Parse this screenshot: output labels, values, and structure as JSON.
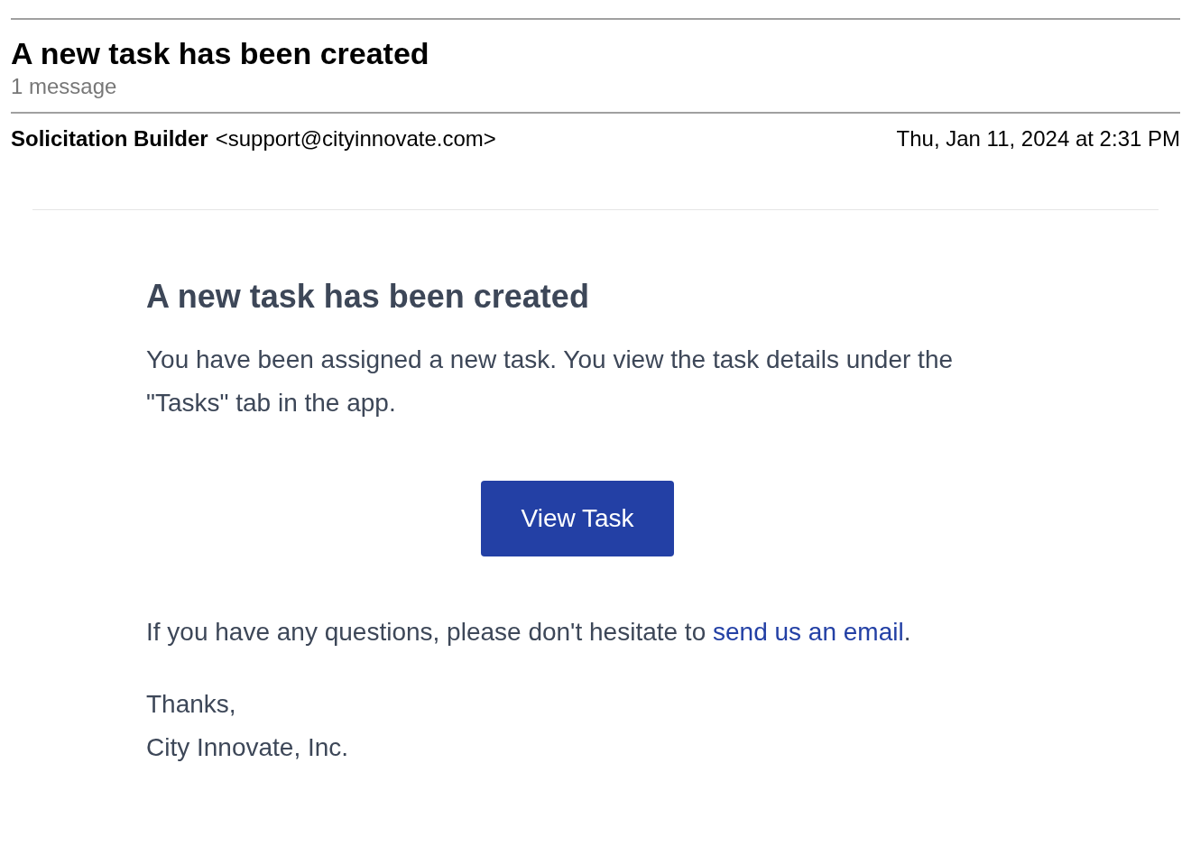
{
  "subject": "A new task has been created",
  "message_count": "1 message",
  "sender": {
    "name": "Solicitation Builder",
    "address": "<support@cityinnovate.com>",
    "date": "Thu, Jan 11, 2024 at 2:31 PM"
  },
  "body": {
    "heading": "A new task has been created",
    "paragraph": "You have been assigned a new task. You view the task details under the \"Tasks\" tab in the app.",
    "button": "View Task",
    "questions": {
      "before": "If you have any questions, please don't hesitate to ",
      "link": "send us an email",
      "after": "."
    },
    "signoff": [
      "Thanks,",
      "City Innovate, Inc."
    ]
  }
}
